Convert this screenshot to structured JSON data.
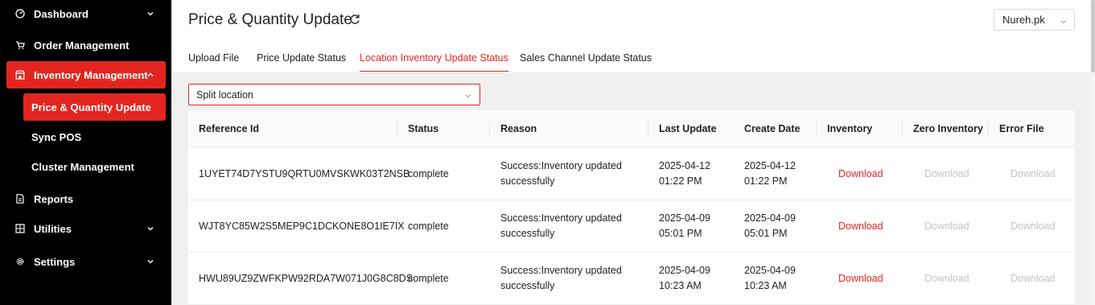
{
  "sidebar": {
    "items": [
      {
        "label": "Dashboard",
        "icon": "dashboard-icon"
      },
      {
        "label": "Order Management",
        "icon": "cart-icon"
      },
      {
        "label": "Inventory Management",
        "icon": "store-icon"
      },
      {
        "label": "Reports",
        "icon": "document-icon"
      },
      {
        "label": "Utilities",
        "icon": "grid-icon"
      },
      {
        "label": "Settings",
        "icon": "gear-icon"
      }
    ],
    "inventory_children": [
      {
        "label": "Price & Quantity Update"
      },
      {
        "label": "Sync POS"
      },
      {
        "label": "Cluster Management"
      }
    ]
  },
  "header": {
    "title": "Price & Quantity Update",
    "store": "Nureh.pk"
  },
  "tabs": [
    {
      "label": "Upload File"
    },
    {
      "label": "Price Update Status"
    },
    {
      "label": "Location Inventory Update Status"
    },
    {
      "label": "Sales Channel Update Status"
    }
  ],
  "filter": {
    "value": "Split location"
  },
  "table": {
    "columns": [
      "Reference Id",
      "Status",
      "Reason",
      "Last Update",
      "Create Date",
      "Inventory",
      "Zero Inventory",
      "Error File"
    ],
    "rows": [
      {
        "reference_id": "1UYET74D7YSTU9QRTU0MVSKWK03T2NSB",
        "status": "complete",
        "reason_line1": "Success:Inventory updated",
        "reason_line2": "successfully",
        "last_update_date": "2025-04-12",
        "last_update_time": "01:22 PM",
        "create_date_date": "2025-04-12",
        "create_date_time": "01:22 PM",
        "inventory": "Download",
        "zero_inventory": "Download",
        "error_file": "Download"
      },
      {
        "reference_id": "WJT8YC85W2S5MEP9C1DCKONE8O1IE7IX",
        "status": "complete",
        "reason_line1": "Success:Inventory updated",
        "reason_line2": "successfully",
        "last_update_date": "2025-04-09",
        "last_update_time": "05:01 PM",
        "create_date_date": "2025-04-09",
        "create_date_time": "05:01 PM",
        "inventory": "Download",
        "zero_inventory": "Download",
        "error_file": "Download"
      },
      {
        "reference_id": "HWU89UZ9ZWFKPW92RDA7W071J0G8C8DS",
        "status": "complete",
        "reason_line1": "Success:Inventory updated",
        "reason_line2": "successfully",
        "last_update_date": "2025-04-09",
        "last_update_time": "10:23 AM",
        "create_date_date": "2025-04-09",
        "create_date_time": "10:23 AM",
        "inventory": "Download",
        "zero_inventory": "Download",
        "error_file": "Download"
      }
    ]
  },
  "colors": {
    "accent": "#e4251f",
    "sidebar_bg": "#000000",
    "disabled_text": "#c4c4c4"
  }
}
